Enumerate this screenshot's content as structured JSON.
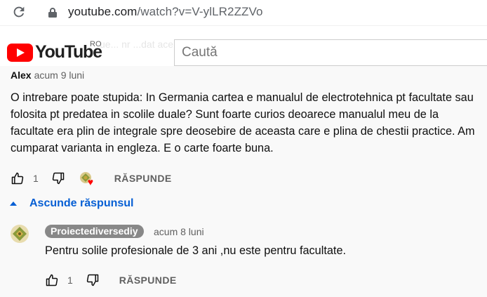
{
  "browser": {
    "url_host": "youtube.com",
    "url_path": "/watch?v=V-ylLR2ZZVo"
  },
  "header": {
    "logo_text": "YouTube",
    "region": "RO",
    "search_placeholder": "Caută",
    "ghost_text": "ue...    nr    ...dat ace..."
  },
  "comment": {
    "author": "Alex",
    "timestamp": "acum 9 luni",
    "text": "O intrebare poate stupida: In Germania cartea e manualul de electrotehnica pt facultate sau folosita pt predatea in scolile duale? Sunt foarte curios deoarece manualul meu de la facultate era plin de integrale spre deosebire de aceasta care e plina de chestii practice. Am cumparat varianta in engleza. E o carte foarte buna.",
    "like_count": "1",
    "reply_label": "RĂSPUNDE"
  },
  "replies_toggle": {
    "label": "Ascunde răspunsul"
  },
  "reply": {
    "author": "Proiectediversediy",
    "timestamp": "acum 8 luni",
    "text": "Pentru solile profesionale de 3 ani ,nu este pentru facultate.",
    "like_count": "1",
    "reply_label": "RĂSPUNDE"
  },
  "colors": {
    "link_blue": "#065fd4",
    "brand_red": "#ff0000",
    "badge_gray": "#888888"
  }
}
